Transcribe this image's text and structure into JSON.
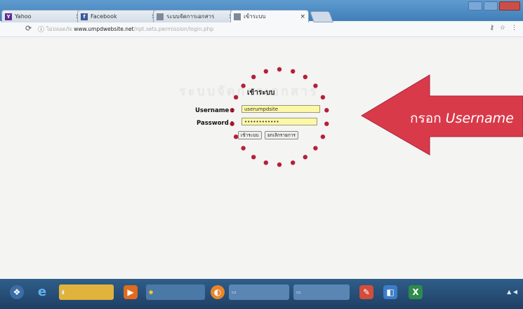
{
  "browser": {
    "tabs": [
      {
        "label": "Yahoo",
        "favicon": "yahoo-icon",
        "favicon_color": "#5b2d8f",
        "active": false
      },
      {
        "label": "Facebook",
        "favicon": "facebook-icon",
        "favicon_color": "#3b5998",
        "active": false
      },
      {
        "label": "ระบบจัดการเอกสาร",
        "favicon": "page-icon",
        "favicon_color": "#7d8a99",
        "active": false
      },
      {
        "label": "เข้าระบบ",
        "favicon": "page-icon",
        "favicon_color": "#7d8a99",
        "active": true
      }
    ],
    "close_glyph": "×",
    "address": {
      "prefix": "ไม่ปลอดภัย",
      "host": "www.umpdwebsite.net",
      "path": "/npt.sets.permission/login.php"
    }
  },
  "page": {
    "watermark": "ระบบจัดการเอกสาร",
    "login": {
      "title": "เข้าระบบ",
      "username_label": "Username :",
      "username_value": "userumpdsite",
      "password_label": "Password :",
      "password_value": "••••••••••••",
      "login_button": "เข้าระบบ",
      "cancel_button": "ยกเลิกรายการ"
    },
    "callout": {
      "text_thai": "กรอก",
      "text_italic": "Username",
      "arrow_color": "#d93a4a",
      "dot_color": "#b5203a"
    }
  },
  "taskbar": {
    "items": [
      {
        "label": "",
        "icon": "ie-icon"
      },
      {
        "label": "",
        "icon": "folder-icon"
      },
      {
        "label": "",
        "icon": "media-icon"
      },
      {
        "label": "",
        "icon": "chrome-icon"
      },
      {
        "label": "",
        "icon": "firefox-icon"
      },
      {
        "label": "",
        "icon": "window-icon"
      },
      {
        "label": "",
        "icon": "window-icon"
      },
      {
        "label": "",
        "icon": "paint-icon"
      },
      {
        "label": "",
        "icon": "excel-icon"
      },
      {
        "label": "",
        "icon": "app-icon"
      }
    ]
  }
}
